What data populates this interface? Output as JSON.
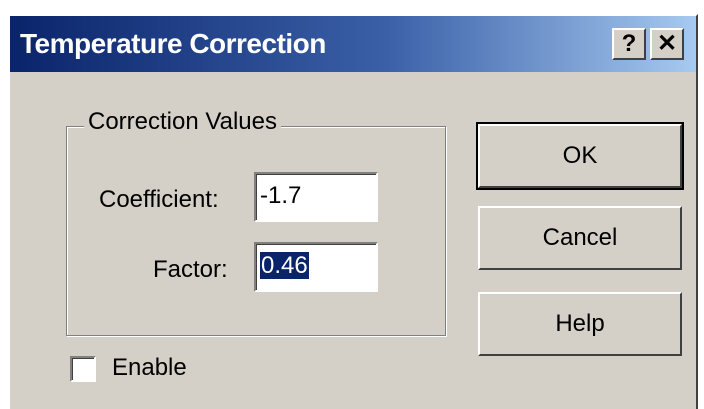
{
  "window": {
    "title": "Temperature Correction",
    "help_glyph": "?",
    "close_glyph": "✕"
  },
  "group": {
    "label": "Correction Values",
    "coefficient_label": "Coefficient:",
    "coefficient_value": "-1.7",
    "factor_label": "Factor:",
    "factor_value": "0.46"
  },
  "buttons": {
    "ok": "OK",
    "cancel": "Cancel",
    "help": "Help"
  },
  "enable": {
    "label": "Enable",
    "checked": false
  },
  "colors": {
    "face": "#d4d0c8",
    "title_start": "#0a246a",
    "title_end": "#a6caf0",
    "selection": "#0a246a"
  }
}
